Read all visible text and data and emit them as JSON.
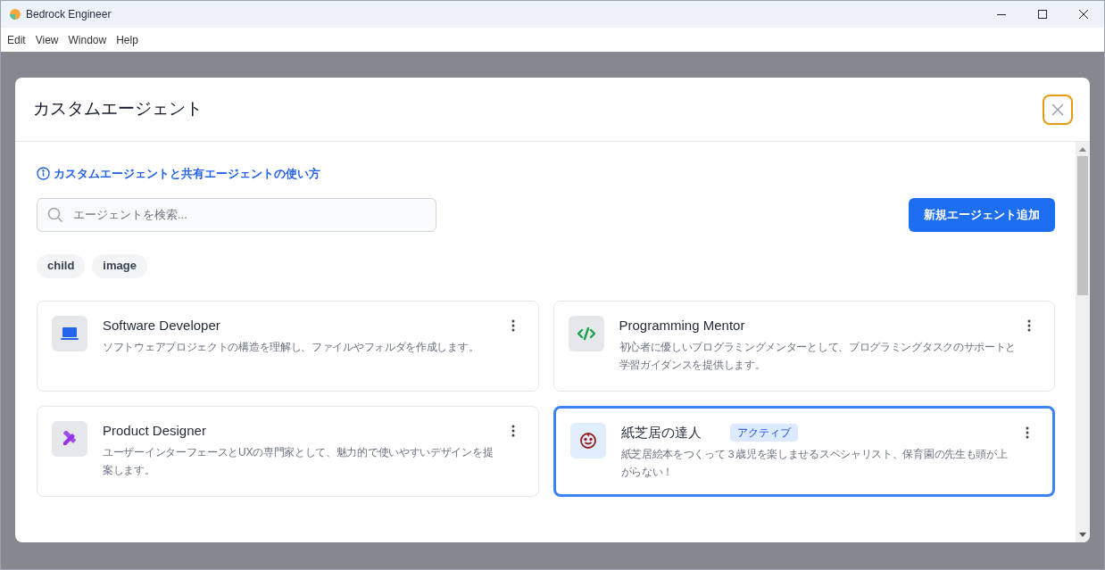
{
  "window": {
    "title": "Bedrock Engineer"
  },
  "menu": [
    "Edit",
    "View",
    "Window",
    "Help"
  ],
  "dialog": {
    "title": "カスタムエージェント",
    "help_link": "カスタムエージェントと共有エージェントの使い方",
    "search": {
      "placeholder": "エージェントを検索..."
    },
    "add_button": "新規エージェント追加",
    "tags": [
      {
        "label": "child",
        "selected": false
      },
      {
        "label": "image",
        "selected": false
      }
    ],
    "agents": [
      {
        "name": "Software Developer",
        "description": "ソフトウェアプロジェクトの構造を理解し、ファイルやフォルダを作成します。",
        "kind": "laptop",
        "active": false
      },
      {
        "name": "Programming Mentor",
        "description": "初心者に優しいプログラミングメンターとして、プログラミングタスクのサポートと学習ガイダンスを提供します。",
        "kind": "code",
        "active": false
      },
      {
        "name": "Product Designer",
        "description": "ユーザーインターフェースとUXの専門家として、魅力的で使いやすいデザインを提案します。",
        "kind": "design",
        "active": false
      },
      {
        "name": "紙芝居の達人",
        "description": "紙芝居絵本をつくって３歳児を楽しませるスペシャリスト、保育園の先生も頭が上がらない！",
        "kind": "face",
        "active": true,
        "badge": "アクティブ"
      }
    ]
  }
}
